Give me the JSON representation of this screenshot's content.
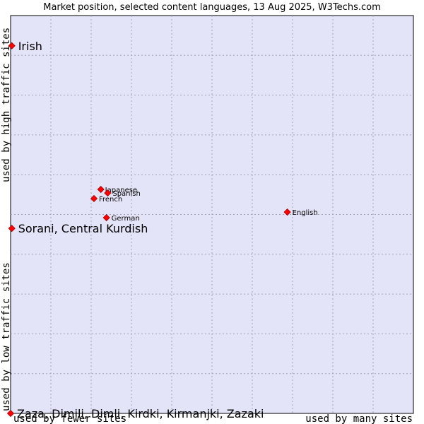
{
  "chart_data": {
    "type": "scatter",
    "title": "Market position, selected content languages, 13 Aug 2025, W3Techs.com",
    "axis_labels": {
      "x_low": "used by fewer sites",
      "x_high": "used by many sites",
      "y_low": "used by low traffic sites",
      "y_high": "used by high traffic sites"
    },
    "xlim": [
      0,
      100
    ],
    "ylim": [
      0,
      100
    ],
    "grid": true,
    "colors": {
      "plot_background": "#e4e4f8",
      "grid": "#a0a0b8",
      "marker": "#ff0000",
      "marker_outline": "#990000"
    },
    "points": [
      {
        "label": "Irish",
        "x": 0.3,
        "y": 92.4,
        "emphasis": true
      },
      {
        "label": "Sorani, Central Kurdish",
        "x": 0.3,
        "y": 46.5,
        "emphasis": true
      },
      {
        "label": "Zaza, Dimili, Dimli, Kirdki, Kirmanjki, Zazaki",
        "x": 0.0,
        "y": 0.0,
        "emphasis": true
      },
      {
        "label": "Japanese",
        "x": 22.4,
        "y": 56.3,
        "emphasis": false
      },
      {
        "label": "Spanish",
        "x": 24.1,
        "y": 55.4,
        "emphasis": false
      },
      {
        "label": "French",
        "x": 20.7,
        "y": 54.0,
        "emphasis": false
      },
      {
        "label": "German",
        "x": 23.8,
        "y": 49.2,
        "emphasis": false
      },
      {
        "label": "English",
        "x": 68.7,
        "y": 50.6,
        "emphasis": false
      }
    ]
  }
}
